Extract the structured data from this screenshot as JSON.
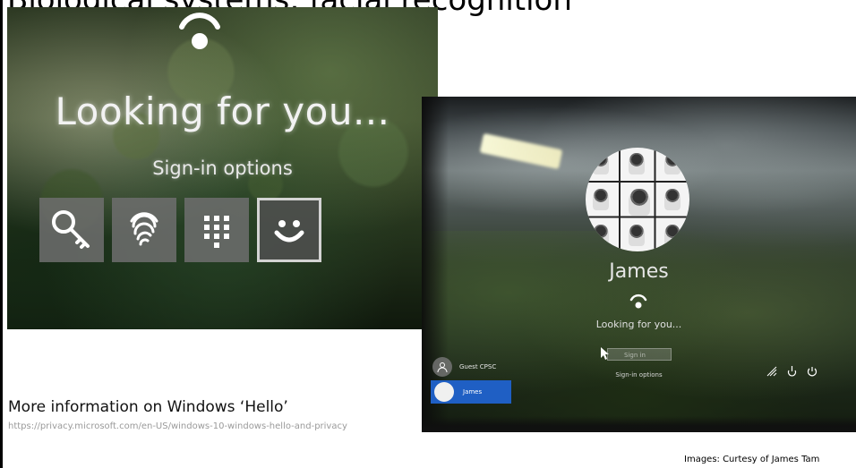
{
  "slide": {
    "title": "Biological systems: facial recognition"
  },
  "left_photo": {
    "status": "Looking for you...",
    "options_label": "Sign-in options",
    "tiles": [
      {
        "icon": "key-icon"
      },
      {
        "icon": "fingerprint-icon"
      },
      {
        "icon": "pin-keypad-icon"
      },
      {
        "icon": "smiley-face-icon",
        "selected": true
      }
    ]
  },
  "right_photo": {
    "user_name": "James",
    "status": "Looking for you...",
    "pin_placeholder": "Sign in",
    "options_label": "Sign-in options",
    "users": [
      {
        "label": "Guest CPSC"
      },
      {
        "label": "James"
      }
    ]
  },
  "footer": {
    "more_info": "More information on Windows ‘Hello’",
    "link": "https://privacy.microsoft.com/en-US/windows-10-windows-hello-and-privacy",
    "credit": "Images: Curtesy of James Tam"
  },
  "colors": {
    "selected_user": "#1f5fc4"
  }
}
